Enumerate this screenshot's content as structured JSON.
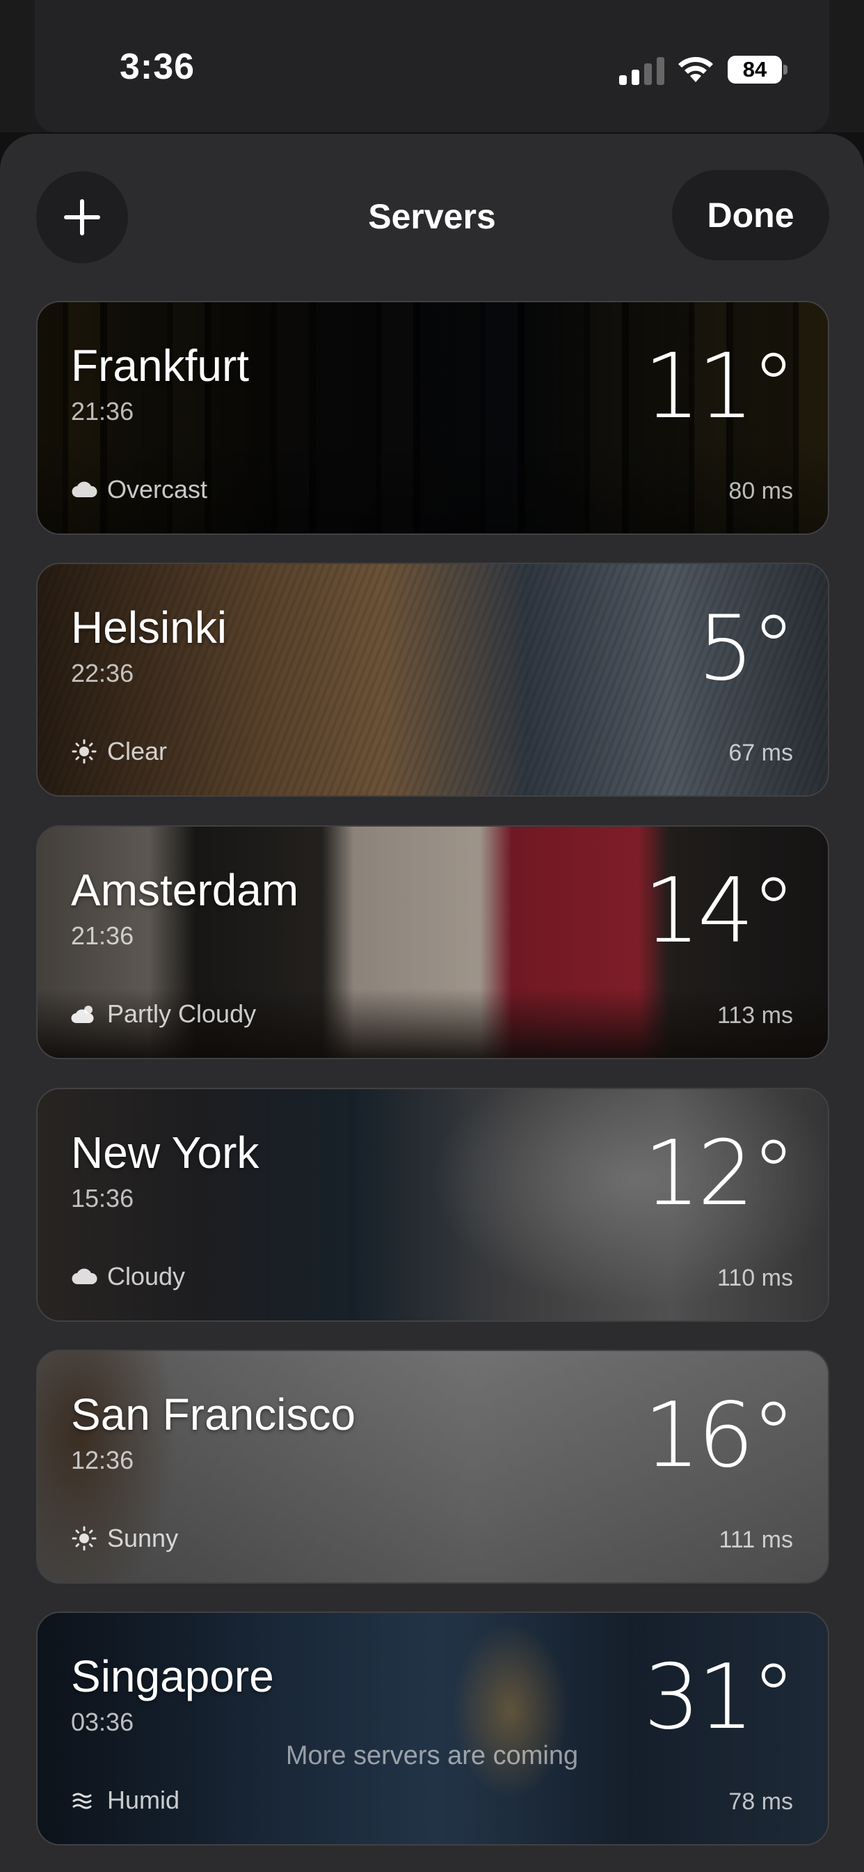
{
  "status_bar": {
    "time": "3:36",
    "battery": "84"
  },
  "header": {
    "title": "Servers",
    "done_label": "Done",
    "add_icon": "plus-icon"
  },
  "servers": [
    {
      "city": "Frankfurt",
      "time": "21:36",
      "condition": "Overcast",
      "condition_icon": "cloud-icon",
      "temp": "11°",
      "ping": "80 ms"
    },
    {
      "city": "Helsinki",
      "time": "22:36",
      "condition": "Clear",
      "condition_icon": "sun-icon",
      "temp": "5°",
      "ping": "67 ms"
    },
    {
      "city": "Amsterdam",
      "time": "21:36",
      "condition": "Partly Cloudy",
      "condition_icon": "cloud-sun-icon",
      "temp": "14°",
      "ping": "113 ms"
    },
    {
      "city": "New York",
      "time": "15:36",
      "condition": "Cloudy",
      "condition_icon": "cloud-icon",
      "temp": "12°",
      "ping": "110 ms"
    },
    {
      "city": "San Francisco",
      "time": "12:36",
      "condition": "Sunny",
      "condition_icon": "sun-icon",
      "temp": "16°",
      "ping": "111 ms"
    },
    {
      "city": "Singapore",
      "time": "03:36",
      "condition": "Humid",
      "condition_icon": "humid-icon",
      "temp": "31°",
      "ping": "78 ms"
    }
  ],
  "footer": {
    "note": "More servers are coming"
  }
}
